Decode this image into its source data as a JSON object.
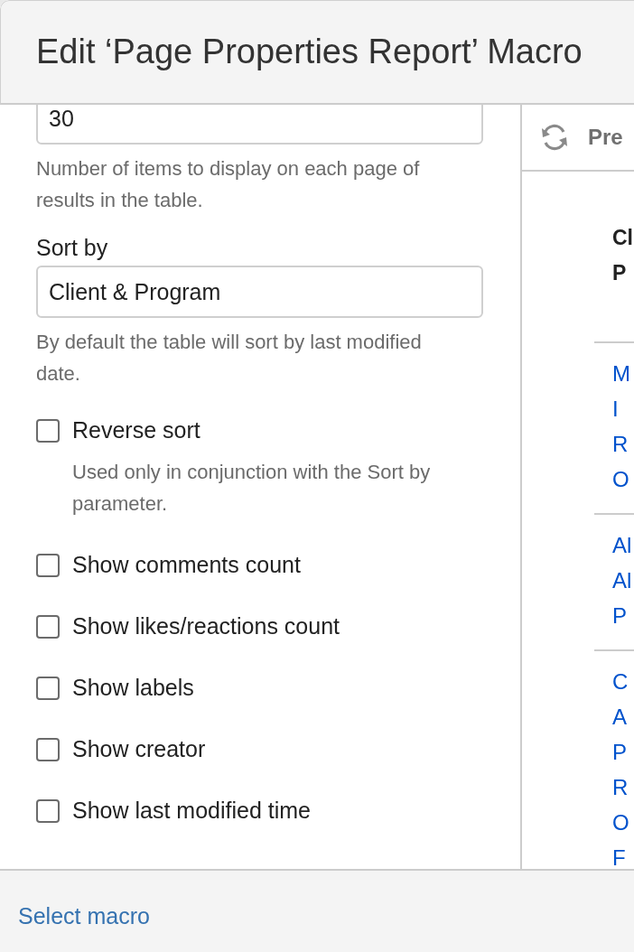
{
  "dialog": {
    "title": "Edit ‘Page Properties Report’ Macro"
  },
  "fields": [
    {
      "value": "30",
      "help": "Number of items to display on each page of results in the table."
    },
    {
      "label": "Sort by",
      "value": "Client & Program",
      "help": "By default the table will sort by last modified date."
    }
  ],
  "options": [
    {
      "label": "Reverse sort",
      "checked": false,
      "help": "Used only in conjunction with the Sort by parameter."
    },
    {
      "label": "Show comments count",
      "checked": false
    },
    {
      "label": "Show likes/reactions count",
      "checked": false
    },
    {
      "label": "Show labels",
      "checked": false
    },
    {
      "label": "Show creator",
      "checked": false
    },
    {
      "label": "Show last modified time",
      "checked": false
    }
  ],
  "preview": {
    "title": "Pre",
    "table": {
      "columns": [
        {
          "lines": [
            "Cl",
            "P"
          ]
        }
      ],
      "rows": [
        {
          "lines": [
            "M",
            "I",
            "R",
            "O"
          ]
        },
        {
          "lines": [
            "Al",
            "Al",
            "P"
          ]
        },
        {
          "lines": [
            "C",
            "A",
            "P",
            "R",
            "O",
            "F"
          ]
        }
      ]
    }
  },
  "footer": {
    "link": "Select macro"
  }
}
